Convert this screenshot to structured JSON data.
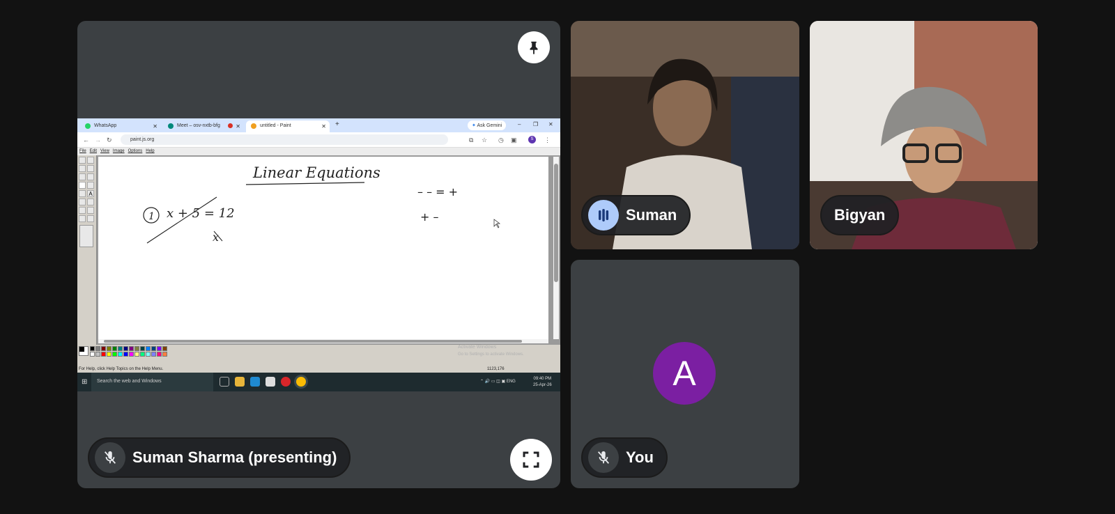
{
  "presenter": {
    "name": "Suman Sharma (presenting)",
    "pin_label": "pin",
    "fullscreen_label": "fullscreen"
  },
  "participants": [
    {
      "name": "Suman",
      "state": "speaking"
    },
    {
      "name": "Bigyan",
      "state": "video"
    },
    {
      "name": "You",
      "initial": "A",
      "avatar_color": "#7b1fa2",
      "state": "muted"
    }
  ],
  "shared_screen": {
    "tabs": [
      {
        "label": "WhatsApp",
        "icon_color": "#25d366"
      },
      {
        "label": "Meet – osv-nxtb-bfg",
        "icon_color": "#00897b"
      },
      {
        "label": "untitled - Paint",
        "icon_color": "#f0a020",
        "active": true
      }
    ],
    "new_tab": "+",
    "ask_gemini": "Ask Gemini",
    "url": "paint.js.org",
    "profile_initial": "S",
    "menu": [
      "File",
      "Edit",
      "View",
      "Image",
      "Options",
      "Help"
    ],
    "canvas_text": {
      "title": "Linear Equations",
      "eq_number": "1",
      "equation": "x + 5  =  12",
      "below": "x",
      "signs_top": "– – = +",
      "signs_bottom": "+  –"
    },
    "status_help": "For Help, click Help Topics on the Help Menu.",
    "coords": "1123,176",
    "activate_title": "Activate Windows",
    "activate_sub": "Go to Settings to activate Windows.",
    "taskbar_search": "Search the web and Windows",
    "tray_lang": "ENG",
    "time": "09:40 PM",
    "date": "25-Apr-26"
  },
  "colors": {
    "page_bg": "#121212",
    "tile_bg": "#3c4043",
    "speaking_accent": "#aecbfa",
    "avatar": "#7b1fa2"
  }
}
